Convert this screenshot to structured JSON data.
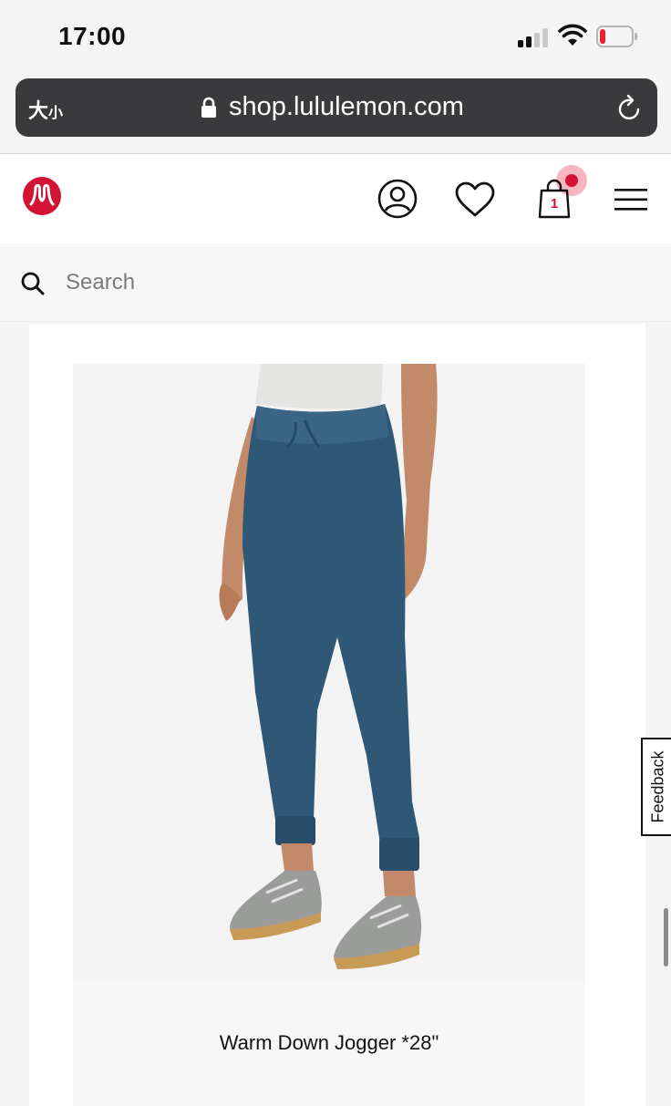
{
  "status_bar": {
    "time": "17:00",
    "signal_bars": 2,
    "battery_level": 0.1
  },
  "browser": {
    "text_size_label": "大",
    "text_size_label_small": "小",
    "url": "shop.lululemon.com"
  },
  "header": {
    "bag_count": "1",
    "brand_color": "#d31334"
  },
  "search": {
    "placeholder": "Search"
  },
  "product": {
    "name": "Warm Down Jogger *28\""
  },
  "feedback": {
    "label": "Feedback"
  },
  "icons": [
    "lock-icon",
    "reload-icon",
    "lululemon-logo-icon",
    "account-icon",
    "heart-icon",
    "shopping-bag-icon",
    "hamburger-menu-icon",
    "search-icon"
  ]
}
